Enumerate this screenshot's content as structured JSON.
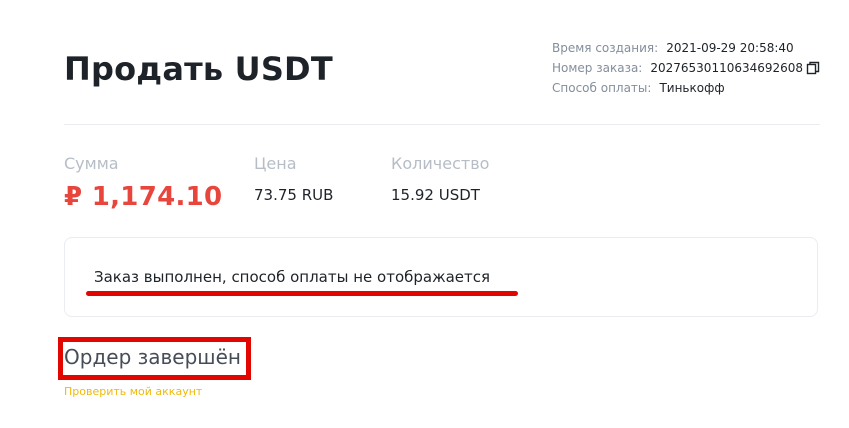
{
  "header": {
    "title": "Продать USDT"
  },
  "order_info": {
    "created_label": "Время создания:",
    "created_value": "2021-09-29 20:58:40",
    "order_label": "Номер заказа:",
    "order_value": "20276530110634692608",
    "payment_label": "Способ оплаты:",
    "payment_value": "Тинькофф",
    "copy_icon": "copy-icon"
  },
  "summary": {
    "amount_label": "Сумма",
    "amount_value": "₽ 1,174.10",
    "price_label": "Цена",
    "price_value": "73.75 RUB",
    "quantity_label": "Количество",
    "quantity_value": "15.92 USDT"
  },
  "notice": {
    "text": "Заказ выполнен, способ оплаты не отображается"
  },
  "status": {
    "text": "Ордер завершён",
    "link": "Проверить мой аккаунт"
  },
  "colors": {
    "amount": "#e8453c",
    "annotation_red": "#e10600",
    "link": "#f0b90b",
    "label_gray": "#848e9c"
  }
}
